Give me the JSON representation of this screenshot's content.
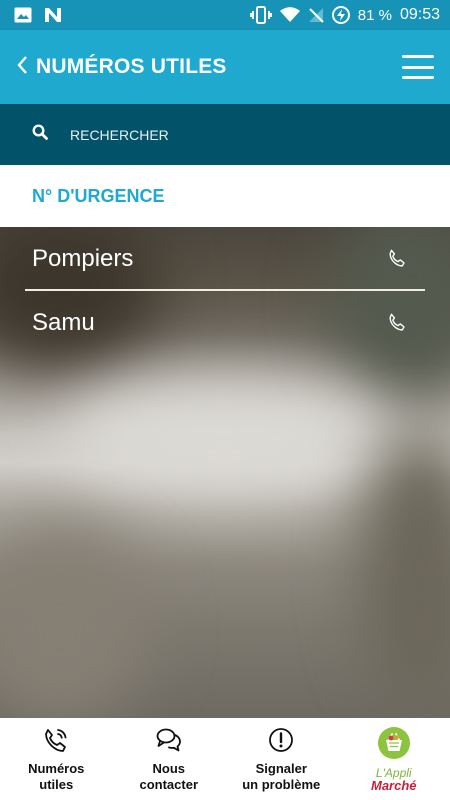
{
  "status_bar": {
    "battery": "81 %",
    "time": "09:53"
  },
  "header": {
    "title": "NUMÉROS UTILES"
  },
  "search": {
    "placeholder": "RECHERCHER"
  },
  "section": {
    "title": "N° D'URGENCE"
  },
  "contacts": [
    {
      "name": "Pompiers"
    },
    {
      "name": "Samu"
    }
  ],
  "bottom_nav": {
    "items": [
      {
        "line1": "Numéros",
        "line2": "utiles",
        "icon": "phone-call-icon"
      },
      {
        "line1": "Nous",
        "line2": "contacter",
        "icon": "chat-bubbles-icon"
      },
      {
        "line1": "Signaler",
        "line2": "un problème",
        "icon": "alert-icon"
      }
    ],
    "logo": {
      "line1": "L'Appli",
      "line2": "Marché"
    }
  },
  "colors": {
    "status_bar": "#1793b8",
    "header": "#1fa9cf",
    "search_bar": "#025269",
    "accent": "#1fa9cf"
  }
}
